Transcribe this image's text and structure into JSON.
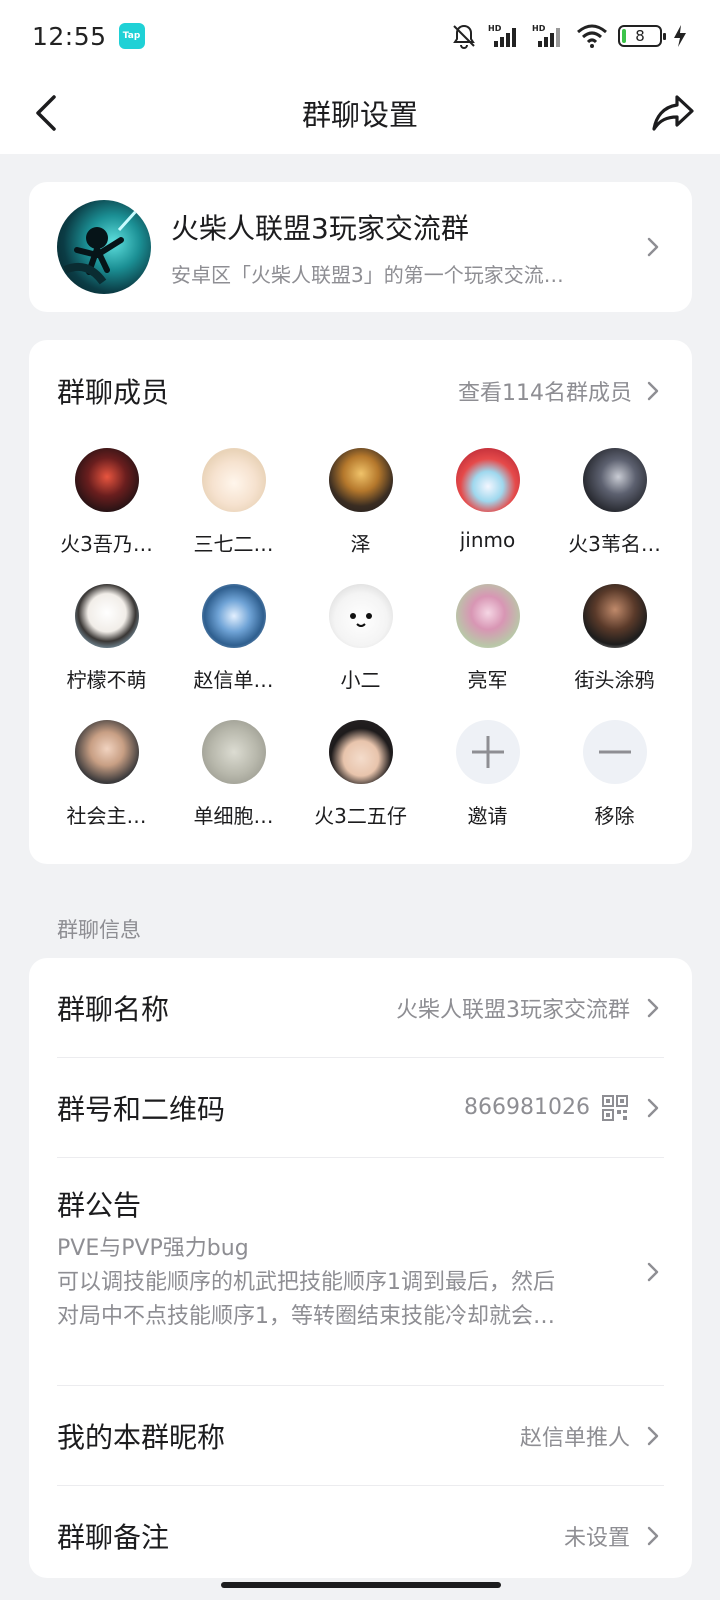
{
  "status_bar": {
    "time": "12:55",
    "app_badge": "Tap",
    "battery": "8",
    "icons": [
      "mute-bell-icon",
      "signal-hd-icon",
      "signal-hd-icon",
      "wifi-icon",
      "battery-icon",
      "charging-icon"
    ]
  },
  "header": {
    "title": "群聊设置",
    "back_icon": "back-arrow-icon",
    "share_icon": "share-icon"
  },
  "group": {
    "name": "火柴人联盟3玩家交流群",
    "description": "安卓区「火柴人联盟3」的第一个玩家交流…"
  },
  "members": {
    "title": "群聊成员",
    "view_all": "查看114名群成员",
    "list": [
      {
        "name": "火3吾乃…"
      },
      {
        "name": "三七二…"
      },
      {
        "name": "泽"
      },
      {
        "name": "jinmo"
      },
      {
        "name": "火3苇名…"
      },
      {
        "name": "柠檬不萌"
      },
      {
        "name": "赵信单…"
      },
      {
        "name": "小二"
      },
      {
        "name": "亮军"
      },
      {
        "name": "街头涂鸦"
      },
      {
        "name": "社会主…"
      },
      {
        "name": "单细胞…"
      },
      {
        "name": "火3二五仔"
      }
    ],
    "invite_label": "邀请",
    "remove_label": "移除"
  },
  "info": {
    "section_label": "群聊信息",
    "group_name_label": "群聊名称",
    "group_name_value": "火柴人联盟3玩家交流群",
    "group_id_label": "群号和二维码",
    "group_id_value": "866981026",
    "notice_label": "群公告",
    "notice_line1": "PVE与PVP强力bug",
    "notice_line2": "可以调技能顺序的机武把技能顺序1调到最后，然后",
    "notice_line3": "对局中不点技能顺序1，等转圈结束技能冷却就会…",
    "nickname_label": "我的本群昵称",
    "nickname_value": "赵信单推人",
    "remark_label": "群聊备注",
    "remark_value": "未设置"
  },
  "colors": {
    "background": "#f1f2f4",
    "card": "#ffffff",
    "primary_text": "#1c1c1e",
    "secondary_text": "#8e8e93",
    "tap_badge": "#1fd1d6",
    "action_circle": "#eef1f6"
  }
}
